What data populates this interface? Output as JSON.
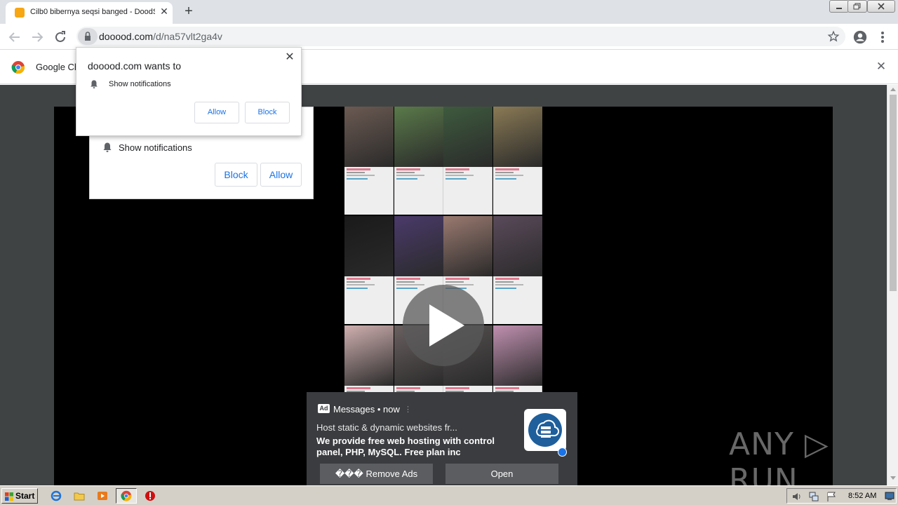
{
  "browser": {
    "tab_title": "Cilb0 bibernya seqsi banged - DoodS",
    "tab_close": "✕",
    "new_tab": "+",
    "url_host": "dooood.com",
    "url_path": "/d/na57vlt2ga4v"
  },
  "infobar": {
    "text": "Google Ch",
    "close": "✕"
  },
  "popup_front": {
    "title": "dooood.com wants to",
    "close": "✕",
    "permission": "Show notifications",
    "allow_label": "Allow",
    "block_label": "Block"
  },
  "popup_back": {
    "permission": "Show notifications",
    "block_label": "Block",
    "allow_label": "Allow"
  },
  "ad": {
    "badge": "Ad",
    "source": "Messages • now",
    "more": "⋮",
    "title": "Host static & dynamic websites fr...",
    "body": "We provide free web hosting with control panel, PHP, MySQL. Free plan inc",
    "remove_label": "��� Remove Ads",
    "open_label": "Open"
  },
  "watermark": "ANY ▷ RUN",
  "taskbar": {
    "start_label": "Start",
    "clock": "8:52 AM"
  },
  "colors": {
    "page_bg": "#404344",
    "video_bg": "#000000",
    "accent": "#1a73e8",
    "ad_bg": "#3a3c3f"
  },
  "thumbnail_colors": [
    [
      "#6b5a52",
      "#5a7a4a",
      "#3e5a3e",
      "#8a7a55"
    ],
    [
      "#1a1a1a",
      "#4a3a6a",
      "#9a7a70",
      "#5a4a5a"
    ],
    [
      "#d0b0b0",
      "#6a6060",
      "#555050",
      "#c090b0"
    ]
  ]
}
